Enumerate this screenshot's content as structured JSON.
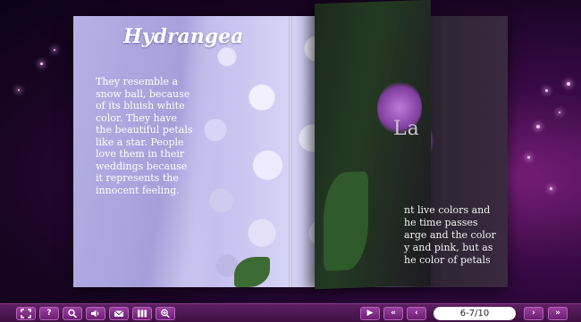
{
  "left_page": {
    "title": "Hydrangea",
    "body": "They resemble a snow ball, because of its bluish white color. They have the beautiful petals like a star. People love them in their weddings because it represents the innocent feeling."
  },
  "flip_page": {
    "partial_title": "La"
  },
  "right_page": {
    "partial_lines": [
      "nt live colors and",
      "he time passes",
      "arge and the color",
      "y and pink, but as",
      "he color of petals"
    ]
  },
  "side_arrows": {
    "left": "◀",
    "right": "▶"
  },
  "toolbar": {
    "left_buttons": [
      {
        "name": "fullscreen-button",
        "icon": "fullscreen-icon",
        "glyph": "⛶"
      },
      {
        "name": "help-button",
        "icon": "help-icon",
        "glyph": "?"
      },
      {
        "name": "zoom-search-button",
        "icon": "magnifier-icon",
        "glyph": "🔍"
      },
      {
        "name": "sound-button",
        "icon": "speaker-icon",
        "glyph": "🔊"
      },
      {
        "name": "email-button",
        "icon": "email-icon",
        "glyph": "✉"
      },
      {
        "name": "thumbnails-button",
        "icon": "thumbnails-icon",
        "glyph": "▦"
      },
      {
        "name": "zoom-in-button",
        "icon": "zoom-in-icon",
        "glyph": "⊕"
      }
    ],
    "nav": {
      "play_glyph": "▶",
      "first_glyph": "«",
      "prev_glyph": "‹",
      "page_indicator": "6-7/10",
      "next_glyph": "›",
      "last_glyph": "»"
    }
  }
}
